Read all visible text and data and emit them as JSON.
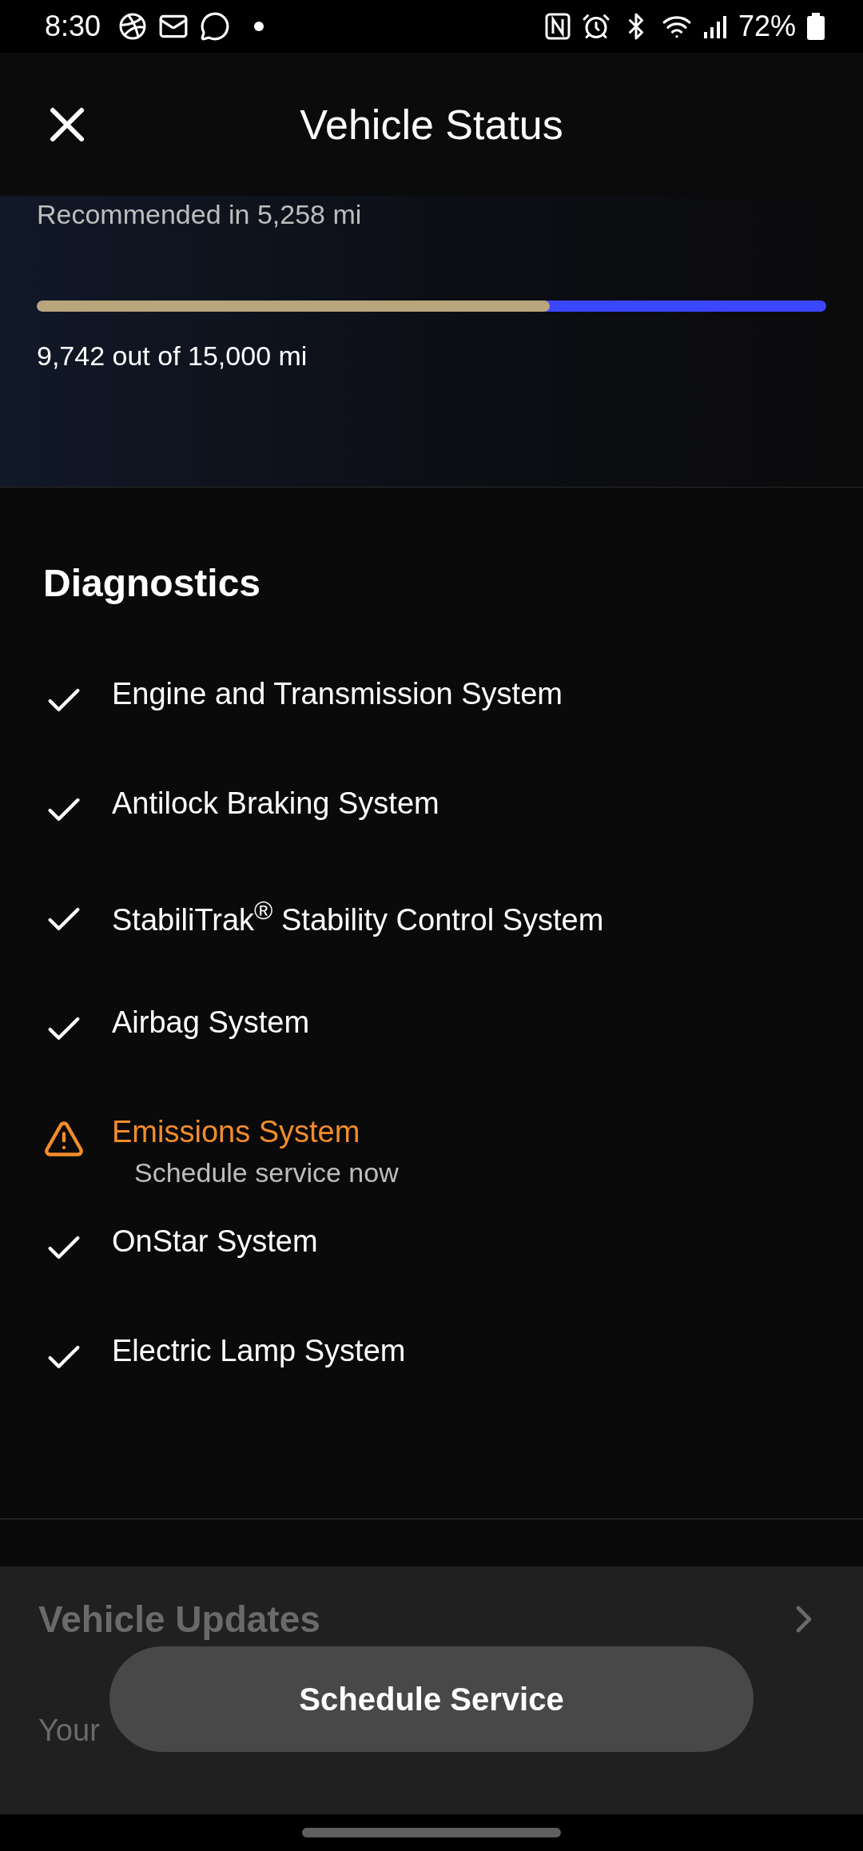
{
  "status_bar": {
    "time": "8:30",
    "battery": "72%"
  },
  "header": {
    "title": "Vehicle Status"
  },
  "maintenance": {
    "note": "Recommended in 5,258 mi",
    "level": 0.65,
    "reading": "9,742 out of 15,000 mi"
  },
  "diagnostics": {
    "title": "Diagnostics",
    "items": [
      {
        "label": "Engine and Transmission System",
        "kind": "ok"
      },
      {
        "label": "Antilock Braking System",
        "kind": "ok"
      },
      {
        "label": "StabiliTrak$^{®}$ Stability Control System",
        "kind": "ok"
      },
      {
        "label": "Airbag System",
        "kind": "ok"
      },
      {
        "label": "Emissions System",
        "kind": "warning",
        "detail": "Schedule service now"
      },
      {
        "label": "OnStar System",
        "kind": "ok"
      },
      {
        "label": "Electric Lamp System",
        "kind": "ok"
      }
    ]
  },
  "updates": {
    "title": "Vehicle Updates",
    "text": "Your"
  },
  "button": {
    "label": "Schedule Service"
  }
}
